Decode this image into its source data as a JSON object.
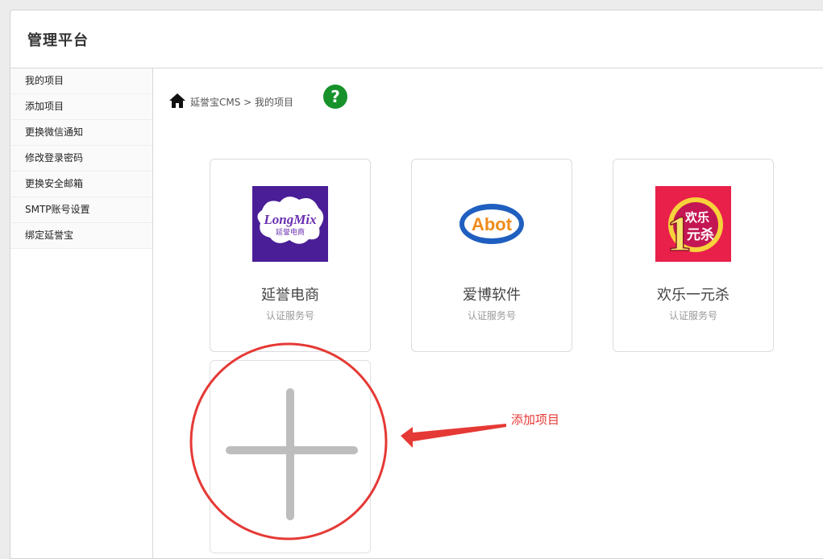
{
  "header": {
    "title": "管理平台"
  },
  "sidebar": {
    "items": [
      {
        "label": "我的项目"
      },
      {
        "label": "添加项目"
      },
      {
        "label": "更换微信通知"
      },
      {
        "label": "修改登录密码"
      },
      {
        "label": "更换安全邮箱"
      },
      {
        "label": "SMTP账号设置"
      },
      {
        "label": "绑定延誉宝"
      }
    ]
  },
  "breadcrumb": {
    "icon": "home-icon",
    "text": "延誉宝CMS > 我的项目"
  },
  "help": {
    "icon": "help-icon",
    "label": "?"
  },
  "projects": [
    {
      "name": "延誉电商",
      "type": "认证服务号",
      "logo_text": "LongMix",
      "logo_sub": "延誉电商"
    },
    {
      "name": "爱博软件",
      "type": "认证服务号",
      "logo_text": "Abot"
    },
    {
      "name": "欢乐一元杀",
      "type": "认证服务号",
      "logo_top": "欢乐",
      "logo_bottom": "元杀",
      "logo_digit": "1"
    }
  ],
  "add_card": {
    "icon": "plus-icon"
  },
  "annotation": {
    "label": "添加项目",
    "color": "#e53935"
  }
}
